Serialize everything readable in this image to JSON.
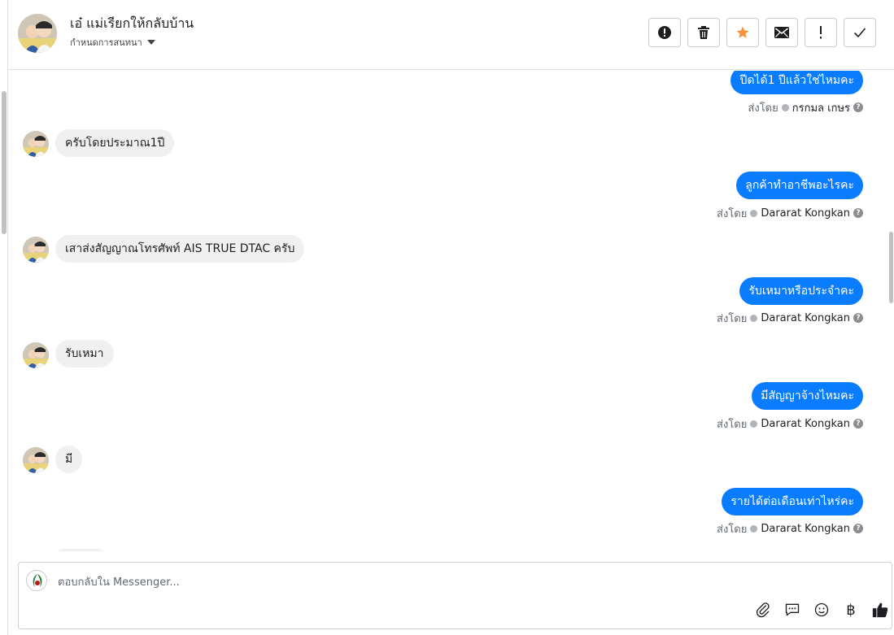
{
  "conversation": {
    "title": "เอ๋ แม่เรียกให้กลับบ้าน",
    "subtitle": "กำหนดการสนทนา"
  },
  "actions": [
    {
      "name": "report-button",
      "icon": "exclamation-circle-icon"
    },
    {
      "name": "delete-button",
      "icon": "trash-icon"
    },
    {
      "name": "star-button",
      "icon": "star-icon"
    },
    {
      "name": "mark-unread-button",
      "icon": "envelope-icon"
    },
    {
      "name": "follow-up-button",
      "icon": "exclamation-icon"
    },
    {
      "name": "done-button",
      "icon": "check-icon"
    }
  ],
  "colors": {
    "accent": "#0a7cff",
    "star": "#f7923b",
    "incoming_bubble": "#f0f0f0"
  },
  "messages": [
    {
      "direction": "out",
      "text": "ปีดได้1 ปีแล้วใช่ไหมคะ",
      "sent_by_label": "ส่งโดย",
      "sender": "กรกมล เกษร"
    },
    {
      "direction": "in",
      "text": "ครับโดยประมาณ1ปี"
    },
    {
      "direction": "out",
      "text": "ลูกค้าทำอาชีพอะไรคะ",
      "sent_by_label": "ส่งโดย",
      "sender": "Dararat Kongkan"
    },
    {
      "direction": "in",
      "text": "เสาส่งสัญญาณโทรศัพท์ AIS TRUE DTAC ครับ"
    },
    {
      "direction": "out",
      "text": "รับเหมาหรือประจำคะ",
      "sent_by_label": "ส่งโดย",
      "sender": "Dararat Kongkan"
    },
    {
      "direction": "in",
      "text": "รับเหมา"
    },
    {
      "direction": "out",
      "text": "มีสัญญาจ้างไหมคะ",
      "sent_by_label": "ส่งโดย",
      "sender": "Dararat Kongkan"
    },
    {
      "direction": "in",
      "text": "มี"
    },
    {
      "direction": "out",
      "text": "รายได้ต่อเดือนเท่าไหร่คะ",
      "sent_by_label": "ส่งโดย",
      "sender": "Dararat Kongkan"
    }
  ],
  "composer": {
    "placeholder": "ตอบกลับใน Messenger...",
    "tools": [
      "paperclip-icon",
      "chat-bubble-icon",
      "emoji-icon",
      "baht-icon",
      "thumbs-up-icon"
    ],
    "currency_symbol": "฿"
  }
}
